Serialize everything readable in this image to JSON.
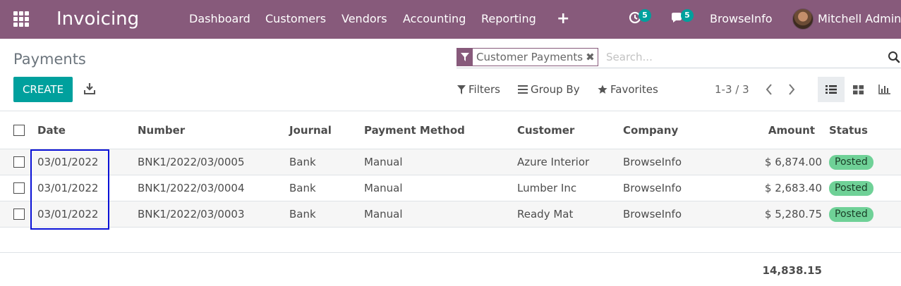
{
  "app": {
    "title": "Invoicing"
  },
  "menu": [
    {
      "label": "Dashboard"
    },
    {
      "label": "Customers"
    },
    {
      "label": "Vendors"
    },
    {
      "label": "Accounting"
    },
    {
      "label": "Reporting"
    }
  ],
  "systray": {
    "activity_count": "5",
    "messages_count": "5",
    "company": "BrowseInfo",
    "user": "Mitchell Admin"
  },
  "page": {
    "title": "Payments"
  },
  "search": {
    "facet": "Customer Payments",
    "placeholder": "Search..."
  },
  "actions": {
    "create_label": "CREATE"
  },
  "controls": {
    "filters": "Filters",
    "group_by": "Group By",
    "favorites": "Favorites",
    "pager": "1-3 / 3"
  },
  "table": {
    "headers": {
      "date": "Date",
      "number": "Number",
      "journal": "Journal",
      "method": "Payment Method",
      "customer": "Customer",
      "company": "Company",
      "amount": "Amount",
      "status": "Status"
    },
    "rows": [
      {
        "date": "03/01/2022",
        "number": "BNK1/2022/03/0005",
        "journal": "Bank",
        "method": "Manual",
        "customer": "Azure Interior",
        "company": "BrowseInfo",
        "amount": "$ 6,874.00",
        "status": "Posted"
      },
      {
        "date": "03/01/2022",
        "number": "BNK1/2022/03/0004",
        "journal": "Bank",
        "method": "Manual",
        "customer": "Lumber Inc",
        "company": "BrowseInfo",
        "amount": "$ 2,683.40",
        "status": "Posted"
      },
      {
        "date": "03/01/2022",
        "number": "BNK1/2022/03/0003",
        "journal": "Bank",
        "method": "Manual",
        "customer": "Ready Mat",
        "company": "BrowseInfo",
        "amount": "$ 5,280.75",
        "status": "Posted"
      }
    ],
    "total": "14,838.15"
  },
  "colors": {
    "navbar": "#875a7b",
    "primary": "#00a09d",
    "posted_badge": "#6fd197",
    "highlight_box": "#0a11d6"
  },
  "icons": [
    "apps-icon",
    "plus-icon",
    "clock-icon",
    "chat-icon",
    "filter-icon",
    "search-icon",
    "download-icon",
    "filter-funnel-icon",
    "group-by-icon",
    "star-icon",
    "chevron-left-icon",
    "chevron-right-icon",
    "list-view-icon",
    "kanban-view-icon",
    "graph-view-icon"
  ]
}
